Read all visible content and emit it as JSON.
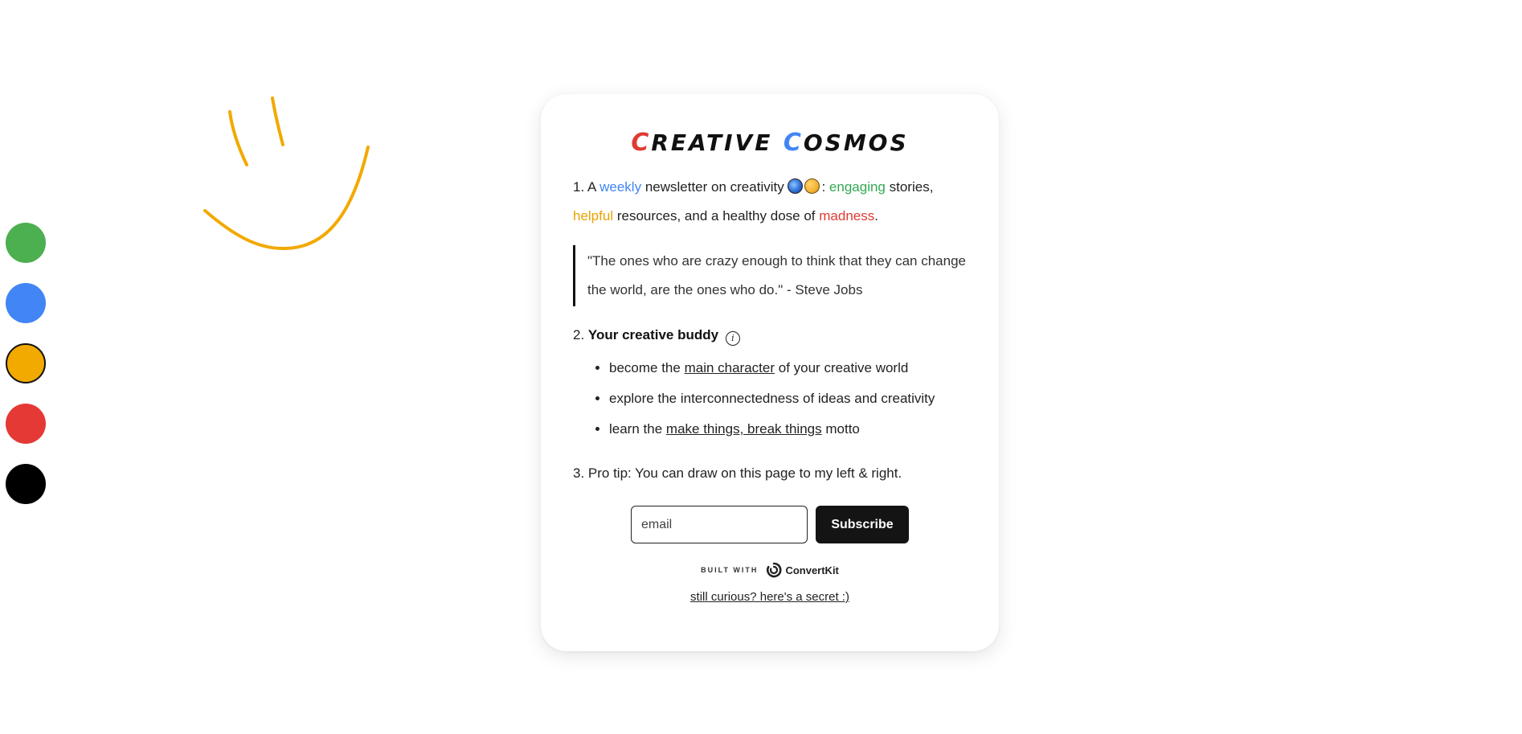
{
  "palette": {
    "colors": [
      {
        "name": "green",
        "hex": "#4caf50",
        "selected": false
      },
      {
        "name": "blue",
        "hex": "#4285f4",
        "selected": false
      },
      {
        "name": "yellow",
        "hex": "#f2a900",
        "selected": true
      },
      {
        "name": "red",
        "hex": "#e53935",
        "selected": false
      },
      {
        "name": "black",
        "hex": "#000000",
        "selected": false
      }
    ]
  },
  "doodle": {
    "stroke_color": "#f2a900",
    "shape": "smiley-face"
  },
  "header": {
    "title_cap1": "C",
    "title_rest1": "REATIVE",
    "title_cap2": "C",
    "title_rest2": "OSMOS"
  },
  "intro": {
    "prefix": "1. A",
    "weekly": "weekly",
    "mid": "newsletter on creativity",
    "emoji1": "planet-emoji",
    "emoji2": "palette-emoji",
    "colon": ":",
    "engaging": "engaging",
    "stories": "stories,",
    "helpful": "helpful",
    "resources": "resources, and a healthy dose of",
    "madness": "madness",
    "period": "."
  },
  "quote": {
    "text": "\"The ones who are crazy enough to think that they can change the world, are the ones who do.\" - Steve Jobs"
  },
  "buddy": {
    "number": "2.",
    "label": "Your creative buddy",
    "info_icon": "info-icon",
    "items": [
      {
        "before": "become the",
        "link": "main character",
        "after": "of your creative world"
      },
      {
        "before": "explore the interconnectedness of ideas and creativity",
        "link": "",
        "after": ""
      },
      {
        "before": "learn the",
        "link": "make things, break things",
        "after": "motto"
      }
    ]
  },
  "tip": {
    "text": "3. Pro tip: You can draw on this page to my left & right."
  },
  "form": {
    "email_placeholder": "email",
    "email_value": "",
    "subscribe_label": "Subscribe"
  },
  "footer": {
    "built_with": "BUILT WITH",
    "brand": "ConvertKit",
    "brand_icon": "convertkit-logo-icon",
    "secret_link": "still curious? here's a secret :)"
  }
}
